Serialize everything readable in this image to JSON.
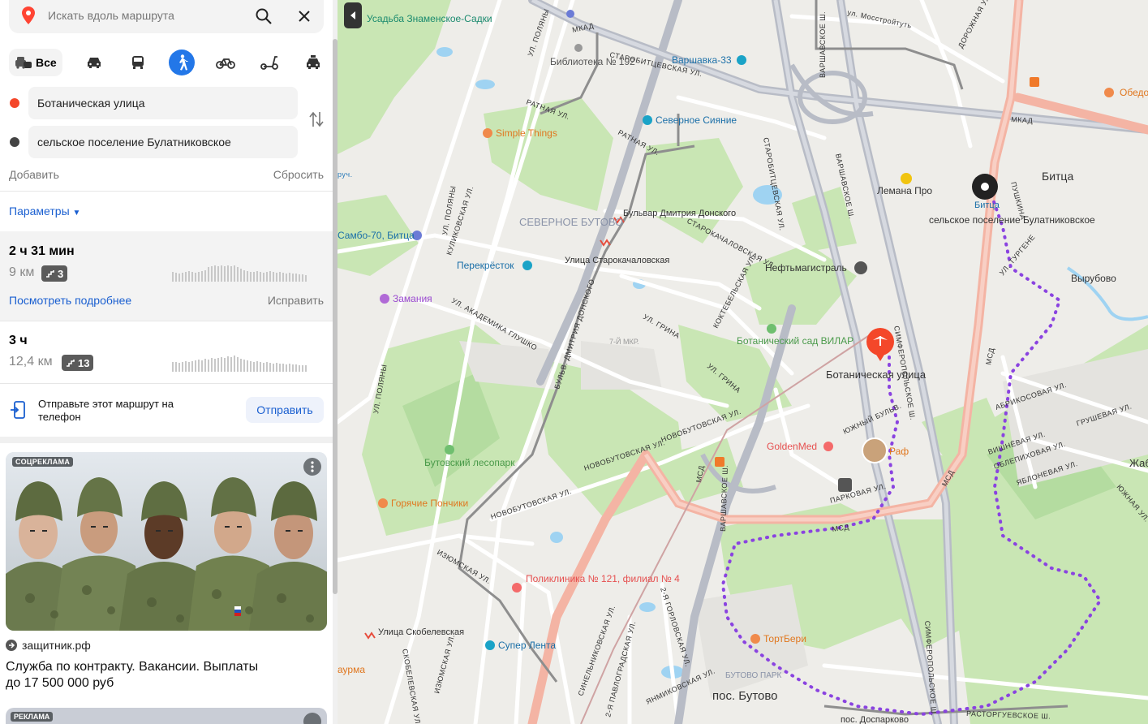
{
  "search": {
    "placeholder": "Искать вдоль маршрута"
  },
  "modes": {
    "all_label": "Все"
  },
  "route_points": {
    "from": "Ботаническая улица",
    "to": "сельское поселение Булатниковское"
  },
  "actions": {
    "add": "Добавить",
    "reset": "Сбросить"
  },
  "params_label": "Параметры",
  "routes": [
    {
      "time": "2 ч 31 мин",
      "distance": "9 км",
      "stairs": "3",
      "details": "Посмотреть подробнее",
      "fix": "Исправить"
    },
    {
      "time": "3 ч",
      "distance": "12,4 км",
      "stairs": "13"
    }
  ],
  "send": {
    "text": "Отправьте этот маршрут на телефон",
    "button": "Отправить"
  },
  "ad": {
    "tag": "СОЦРЕКЛАМА",
    "site": "защитник.рф",
    "title": "Служба по контракту. Вакансии. Выплаты до 17 500 000 руб",
    "tag2": "РЕКЛАМА"
  },
  "map": {
    "labels": {
      "usadba": "Усадьба Знаменское-Садки",
      "biblioteka": "Библиотека № 192",
      "varshavka33": "Варшавка-33",
      "mkad": "МКАД",
      "mosstroy": "ул. Мосстройтуть",
      "simple": "Simple Things",
      "severnoe_siyanie": "Северное Сияние",
      "lemana": "Лемана Про",
      "bitsa": "Битца",
      "bitsa_stop": "Битца",
      "bulatn": "сельское поселение Булатниковское",
      "vyrubovo": "Вырубово",
      "obedo": "Обедо",
      "sev_butovo": "СЕВЕРНОЕ БУТОВО",
      "bulvar": "Бульвар Дмитрия Донского",
      "starokach": "Улица Старокачаловская",
      "sambo": "Самбо-70, Битца",
      "perekrestok": "Перекрёсток",
      "neftemag": "Нефтьмагистраль",
      "zamania": "Замания",
      "botsad": "Ботанический сад ВИЛАР",
      "botul": "Ботаническая улица",
      "mkr7": "7-Й МКР.",
      "goldenmed": "GoldenMed",
      "raf": "Раф",
      "butlespark": "Бутовский лесопарк",
      "ponchiki": "Горячие Пончики",
      "poliklinika": "Поликлиника № 121, филиал № 4",
      "skobel": "Улица Скобелевская",
      "superlenta": "Супер Лента",
      "tortberi": "ТортБери",
      "butovo_park": "БУТОВО ПАРК",
      "pos_butovo": "пос. Бутово",
      "pos_dos": "пос. Доспарково",
      "aurma": "аурма",
      "zhabk": "Жабк",
      "msd": "МСД",
      "mcad2": "МКАД",
      "varsh_sh": "ВАРШАВСКОЕ Ш.",
      "simf_sh": "СИМФЕРОПОЛЬСКОЕ Ш.",
      "novobut": "НОВОБУТОВСКАЯ УЛ.",
      "ul_grina": "УЛ. ГРИНА",
      "ul_polyany": "УЛ. ПОЛЯНЫ",
      "kulikovskaya": "КУЛИКОВСКАЯ УЛ.",
      "akad_glushko": "УЛ. АКАДЕМИКА ГЛУШКО",
      "starokachal": "СТАРОКАЧАЛОВСКАЯ УЛ.",
      "ratnaya": "РАТНАЯ УЛ.",
      "koktebel": "КОКТЕБЕЛЬСКАЯ УЛ.",
      "izyum": "ИЗЮМСКАЯ УЛ.",
      "rastorg": "РАСТОРГУЕВСКОЕ Ш.",
      "yuzhny": "ЮЖНЫЙ БУЛЬВ.",
      "parkovaya": "ПАРКОВАЯ УЛ.",
      "bulv_dd": "БУЛЬВ. ДМИТРИЯ ДОНСКОГО",
      "abrikos": "АБРИКОСОВАЯ УЛ.",
      "grushev": "ГРУШЕВАЯ УЛ.",
      "vishnev": "ВИШНЁВАЯ УЛ.",
      "oblepikh": "ОБЛЕПИХОВАЯ УЛ.",
      "yablon": "ЯБЛОНЕВАЯ УЛ.",
      "yuzhnaya": "ЮЖНАЯ УЛ.",
      "starobitc": "СТАРОБИТЦЕВСКАЯ УЛ.",
      "dorozhnaya": "ДОРОЖНАЯ УЛ.",
      "pushkina": "ПУШКИНА",
      "turgen": "УЛ. ТУРГЕНЕ",
      "skobel_ul": "СКОБЕЛЕВСКАЯ УЛ.",
      "gorlov": "2-Я ГОРЛОВСКАЯ УЛ.",
      "sinelnik": "СИНЕЛЬНИКОВСКАЯ УЛ.",
      "pavlograd": "2-Я ПАВЛОГРАДСКАЯ УЛ.",
      "yanmiko": "ЯНМИКОВСКАЯ УЛ.",
      "ruch": "руч."
    }
  },
  "colors": {
    "accent": "#2377e8",
    "route": "#8a43e0",
    "start_marker": "#f4472a"
  }
}
